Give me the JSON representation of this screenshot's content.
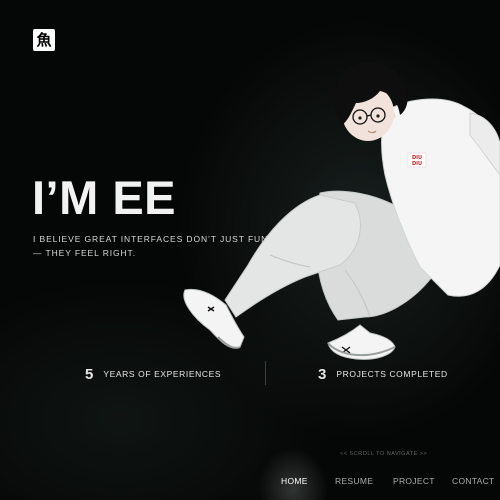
{
  "logo": {
    "glyph": "魚"
  },
  "hero": {
    "title": "I’M EE",
    "tagline_line1": "I BELIEVE GREAT INTERFACES DON’T JUST FUNCTION",
    "tagline_line2": "— THEY FEEL RIGHT."
  },
  "stats": [
    {
      "number": "5",
      "label": "YEARS OF EXPERIENCES"
    },
    {
      "number": "3",
      "label": "PROJECTS COMPLETED"
    }
  ],
  "character": {
    "shirt_text": "DIU DIU"
  },
  "scroll_hint": "<< SCROLL TO NAVIGATE >>",
  "nav": {
    "active": "HOME",
    "items": [
      "HOME",
      "RESUME",
      "PROJECT",
      "CONTACT"
    ]
  },
  "colors": {
    "background": "#050706",
    "text": "#f2f2f2",
    "muted": "#5f6664",
    "shirt_logo": "#c0262b"
  }
}
